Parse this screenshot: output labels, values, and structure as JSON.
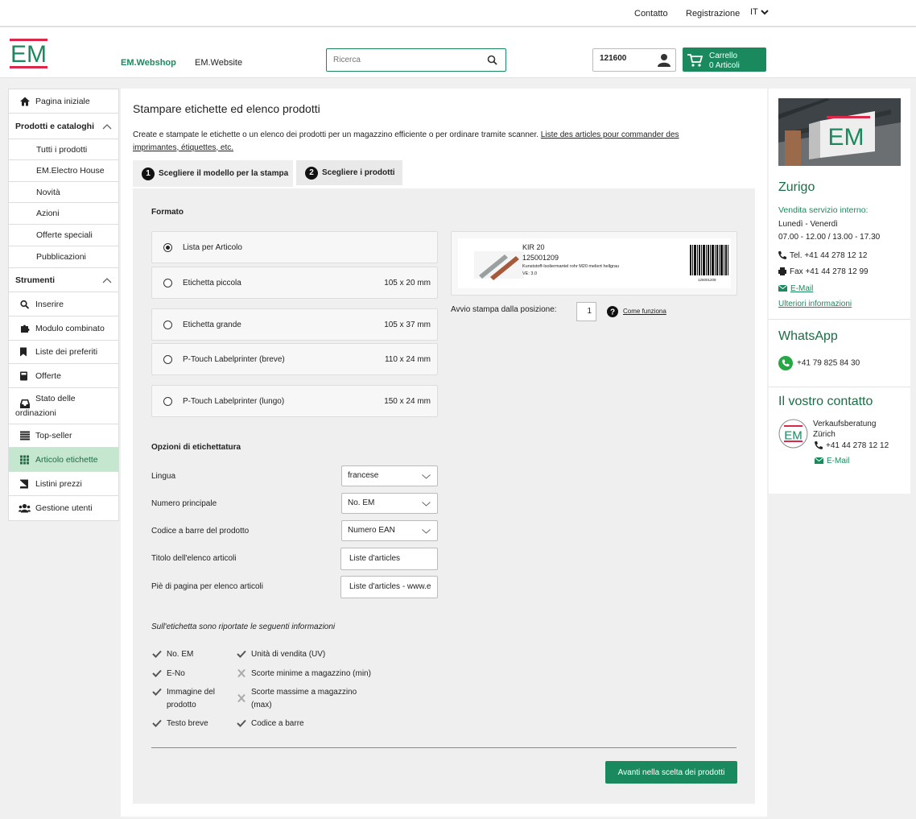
{
  "topbar": {
    "contact": "Contatto",
    "register": "Registrazione",
    "lang": "IT"
  },
  "header": {
    "logo_text": "EM",
    "nav": [
      "EM.Webshop",
      "EM.Website"
    ],
    "search_placeholder": "Ricerca",
    "account_number": "121600",
    "cart_label": "Carrello",
    "cart_count": "0 Articoli"
  },
  "sidebar": {
    "home": "Pagina iniziale",
    "products_section": "Prodotti e cataloghi",
    "products": [
      "Tutti i prodotti",
      "EM.Electro House",
      "Novità",
      "Azioni",
      "Offerte speciali",
      "Pubblicazioni"
    ],
    "tools_section": "Strumenti",
    "tools": [
      "Inserire",
      "Modulo combinato",
      "Liste dei preferiti",
      "Offerte",
      "Stato delle",
      "ordinazioni",
      "Top-seller",
      "Articolo etichette",
      "Listini prezzi",
      "Gestione utenti"
    ]
  },
  "main": {
    "title": "Stampare etichette ed elenco prodotti",
    "intro": "Create e stampate le etichette o un elenco dei prodotti per un magazzino efficiente o per ordinare tramite scanner.",
    "intro_link": "Liste des articles pour commander des imprimantes, étiquettes, etc.",
    "tabs": [
      {
        "num": "1",
        "label": "Scegliere il modello per la stampa"
      },
      {
        "num": "2",
        "label": "Scegliere i prodotti"
      }
    ],
    "format_heading": "Formato",
    "formats": [
      {
        "label": "Lista per Articolo",
        "dim": "",
        "selected": true
      },
      {
        "label": "Etichetta piccola",
        "dim": "105 x 20 mm",
        "selected": false
      },
      {
        "label": "Etichetta grande",
        "dim": "105 x 37 mm",
        "selected": false
      },
      {
        "label": "P-Touch Labelprinter (breve)",
        "dim": "110 x 24 mm",
        "selected": false
      },
      {
        "label": "P-Touch Labelprinter (lungo)",
        "dim": "150 x 24 mm",
        "selected": false
      }
    ],
    "preview": {
      "code": "KIR 20",
      "number": "125001209",
      "desc": "Kunststoff-Isoliermantel rohr M20 meliert hellgrau",
      "ve": "VE: 3.0",
      "barcode_text": "125001209"
    },
    "start_pos_label": "Avvio stampa dalla posizione:",
    "start_pos_value": "1",
    "how_link": "Come funziona",
    "options_heading": "Opzioni di etichettatura",
    "options": {
      "language_label": "Lingua",
      "language_value": "francese",
      "mainnum_label": "Numero principale",
      "mainnum_value": "No. EM",
      "barcode_label": "Codice a barre del prodotto",
      "barcode_value": "Numero EAN",
      "list_title_label": "Titolo dell'elenco articoli",
      "list_title_value": "Liste d'articles",
      "footer_label": "Piè di pagina per elenco articoli",
      "footer_value": "Liste d'articles - www.e"
    },
    "info_heading": "Sull'etichetta sono riportate le seguenti informazioni",
    "features_left": [
      {
        "text": "No. EM",
        "on": true
      },
      {
        "text": "E-No",
        "on": true
      },
      {
        "text": "Immagine del prodotto",
        "on": true
      },
      {
        "text": "Testo breve",
        "on": true
      }
    ],
    "features_right": [
      {
        "text": "Unità di vendita (UV)",
        "on": true
      },
      {
        "text": "Scorte minime a magazzino (min)",
        "on": false
      },
      {
        "text": "Scorte massime a magazzino (max)",
        "on": false
      },
      {
        "text": "Codice a barre",
        "on": true
      }
    ],
    "next_button": "Avanti nella scelta dei prodotti"
  },
  "right": {
    "city": "Zurigo",
    "service": "Vendita servizio interno:",
    "days": "Lunedì - Venerdì",
    "hours": "07.00 - 12.00 / 13.00 - 17.30",
    "tel": "Tel. +41 44 278 12 12",
    "fax": "Fax +41 44 278 12 99",
    "email": "E-Mail",
    "more": "Ulteriori informazioni",
    "whatsapp_title": "WhatsApp",
    "whatsapp_number": "+41 79 825 84 30",
    "contact_title": "Il vostro contatto",
    "contact_name1": "Verkaufsberatung",
    "contact_name2": "Zürich",
    "contact_tel": "+41 44 278 12 12",
    "contact_email": "E-Mail"
  },
  "colors": {
    "brand_green": "#1a8a5e",
    "logo_red": "#d9284a",
    "active_bg": "#c5e6cf"
  }
}
